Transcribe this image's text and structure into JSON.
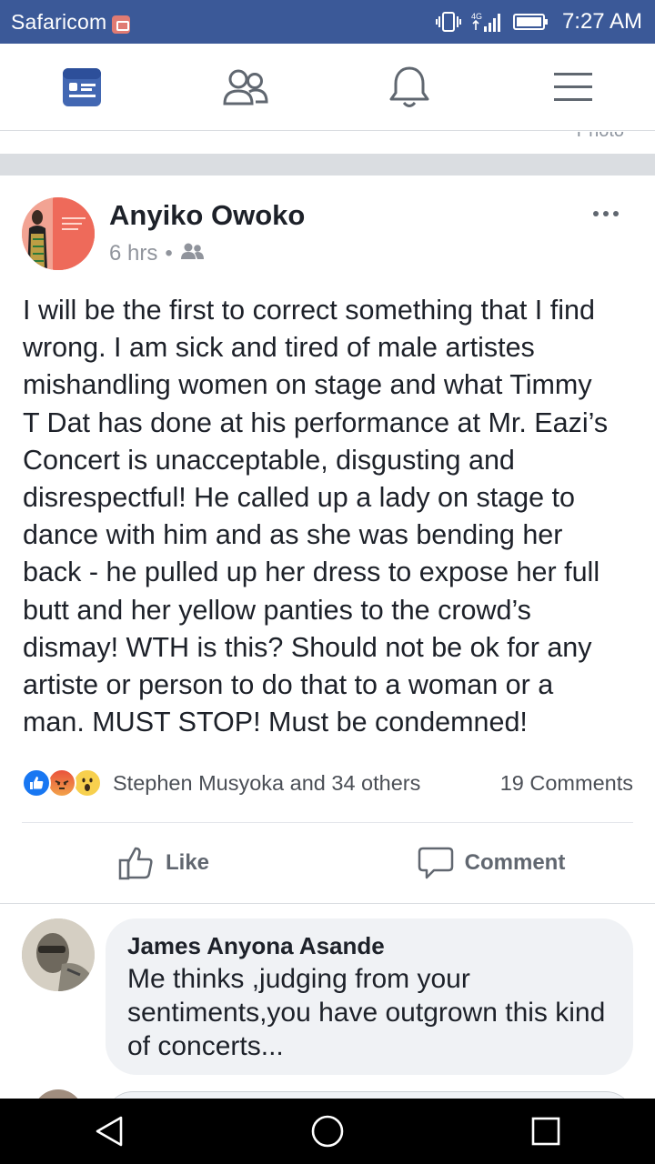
{
  "status_bar": {
    "carrier": "Safaricom",
    "network": "4G",
    "time": "7:27 AM"
  },
  "top_nav": {
    "tabs": [
      {
        "icon": "news-feed-icon",
        "active": true
      },
      {
        "icon": "friends-icon",
        "active": false
      },
      {
        "icon": "notifications-icon",
        "active": false
      },
      {
        "icon": "menu-icon",
        "active": false
      }
    ],
    "active_color": "#4267b2",
    "inactive_color": "#606770"
  },
  "prev_post": {
    "fragment": "Photo"
  },
  "post": {
    "author": "Anyiko Owoko",
    "time": "6 hrs",
    "separator": "•",
    "audience_icon": "friends-audience-icon",
    "text": "I will be the first to correct something that I find\nwrong. I am sick and tired of male artistes\nmishandling women on stage and what Timmy\nT Dat has done at his performance at Mr. Eazi’s\nConcert is unacceptable, disgusting and\ndisrespectful! He called up a lady on stage to\ndance with him and as she was bending her\nback - he pulled up her dress to expose her full\nbutt and her yellow panties to the crowd’s\ndismay! WTH is this? Should not be ok for any\nartiste or person to do that to a woman or a\nman. MUST STOP! Must be condemned!",
    "reactions": [
      "like",
      "angry",
      "wow"
    ],
    "reactors_text": "Stephen Musyoka and 34 others",
    "comments_count_text": "19 Comments",
    "like_label": "Like",
    "comment_label": "Comment"
  },
  "comments": [
    {
      "author": "James Anyona Asande",
      "text": "Me thinks ,judging from your sentiments,you have outgrown this kind of concerts..."
    }
  ],
  "system_nav": {
    "buttons": [
      "back-icon",
      "home-icon",
      "recents-icon"
    ]
  }
}
